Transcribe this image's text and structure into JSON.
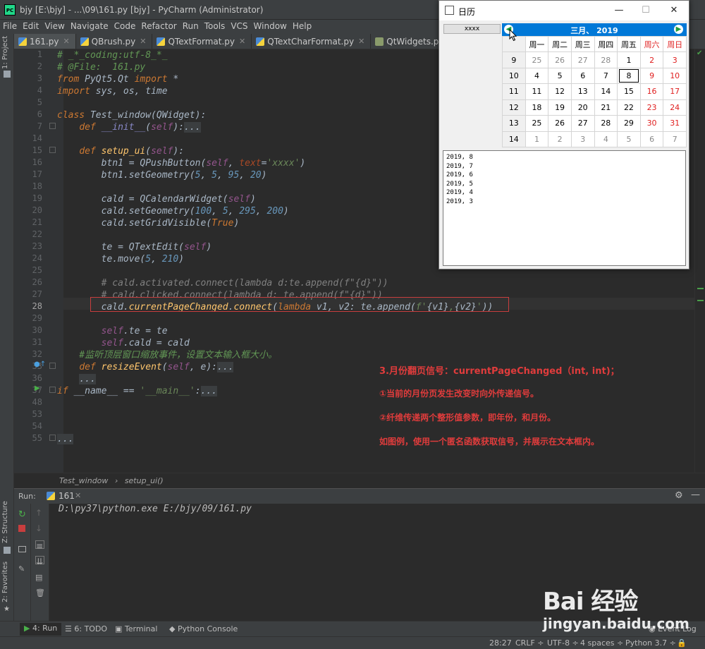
{
  "window": {
    "title": "bjy [E:\\bjy] - ...\\09\\161.py [bjy] - PyCharm (Administrator)",
    "logo": "PC"
  },
  "menu": [
    "File",
    "Edit",
    "View",
    "Navigate",
    "Code",
    "Refactor",
    "Run",
    "Tools",
    "VCS",
    "Window",
    "Help"
  ],
  "tabs": [
    {
      "label": "161.py",
      "active": true,
      "icon": "python-file-icon"
    },
    {
      "label": "QBrush.py",
      "icon": "python-file-icon"
    },
    {
      "label": "QTextFormat.py",
      "icon": "python-file-icon"
    },
    {
      "label": "QTextCharFormat.py",
      "icon": "python-file-icon"
    },
    {
      "label": "QtWidgets.pyi",
      "icon": "pyi-file-icon"
    },
    {
      "label": "Q",
      "icon": "python-file-icon"
    }
  ],
  "left_strip": {
    "project": "1: Project",
    "structure": "Z: Structure",
    "favorites": "2: Favorites"
  },
  "line_numbers": [
    "1",
    "2",
    "3",
    "4",
    "5",
    "6",
    "7",
    "14",
    "15",
    "16",
    "17",
    "18",
    "19",
    "20",
    "21",
    "22",
    "23",
    "24",
    "25",
    "26",
    "27",
    "28",
    "29",
    "30",
    "31",
    "32",
    "33",
    "36",
    "37",
    "48",
    "53",
    "54",
    "55",
    "56"
  ],
  "current_line": "28",
  "breadcrumb": {
    "item1": "Test_window",
    "sep": "›",
    "item2": "setup_ui()"
  },
  "run": {
    "label": "Run:",
    "config": "161",
    "command": "D:\\py37\\python.exe E:/bjy/09/161.py"
  },
  "bottom_tabs": {
    "run": "4: Run",
    "todo": "6: TODO",
    "terminal": "Terminal",
    "console": "Python Console",
    "event_log": "Event Log"
  },
  "status": {
    "position": "28:27",
    "line_sep": "CRLF ÷",
    "encoding": "UTF-8 ÷",
    "indent": "4 spaces ÷",
    "interpreter": "Python 3.7 ÷"
  },
  "annotation": [
    "3.月份翻页信号：currentPageChanged（int, int)；",
    "①当前的月份页发生改变时向外传递信号。",
    "②纤维传递两个整形值参数，即年份，和月份。",
    "如图例，使用一个匿名函数获取信号，并展示在文本框内。"
  ],
  "calendar_window": {
    "title": "日历",
    "minimize": "—",
    "maximize": "☐",
    "close": "✕",
    "button_text": "xxxx",
    "month_label": "三月、 2019",
    "headers": [
      "",
      "周一",
      "周二",
      "周三",
      "周四",
      "周五",
      "周六",
      "周日"
    ],
    "rows": [
      [
        "9",
        "25",
        "26",
        "27",
        "28",
        "1",
        "2",
        "3"
      ],
      [
        "10",
        "4",
        "5",
        "6",
        "7",
        "8",
        "9",
        "10"
      ],
      [
        "11",
        "11",
        "12",
        "13",
        "14",
        "15",
        "16",
        "17"
      ],
      [
        "12",
        "18",
        "19",
        "20",
        "21",
        "22",
        "23",
        "24"
      ],
      [
        "13",
        "25",
        "26",
        "27",
        "28",
        "29",
        "30",
        "31"
      ],
      [
        "14",
        "1",
        "2",
        "3",
        "4",
        "5",
        "6",
        "7"
      ]
    ],
    "text_lines": [
      "2019, 8",
      "2019, 7",
      "2019, 6",
      "2019, 5",
      "2019, 4",
      "2019, 3"
    ]
  },
  "watermark": {
    "brand": "Bai 经验",
    "url": "jingyan.baidu.com"
  }
}
